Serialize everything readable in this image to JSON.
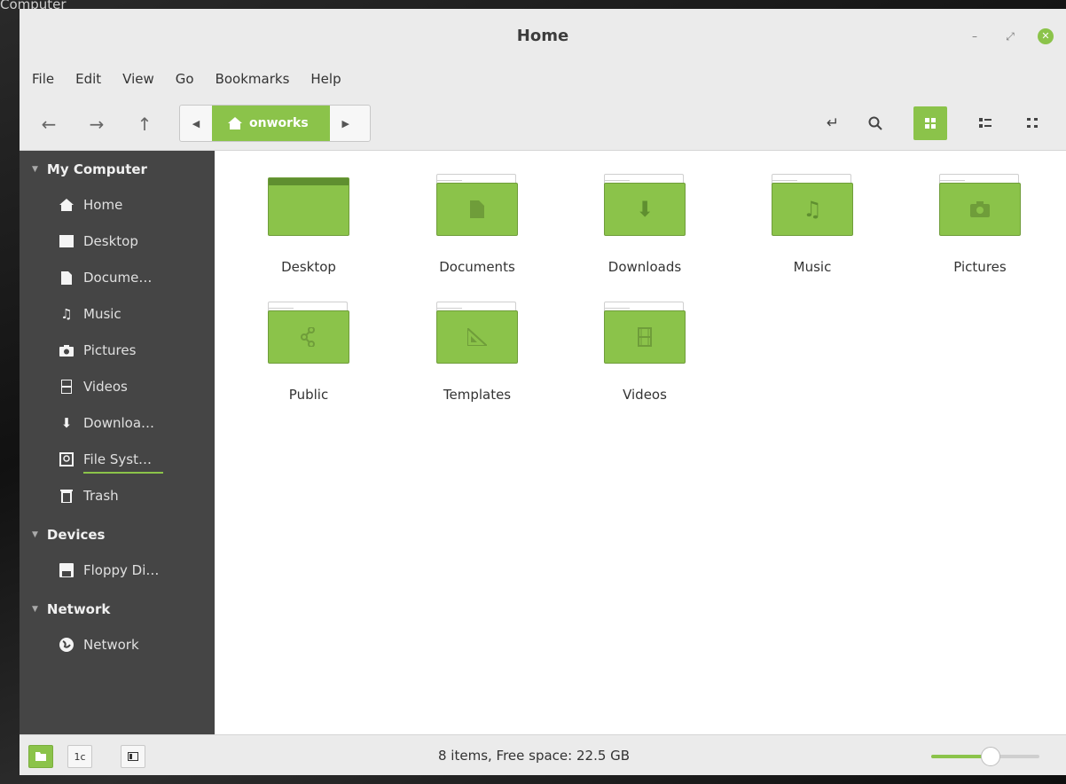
{
  "desktop": {
    "label": "Computer"
  },
  "window": {
    "title": "Home"
  },
  "menu": [
    "File",
    "Edit",
    "View",
    "Go",
    "Bookmarks",
    "Help"
  ],
  "toolbar": {
    "location": "onworks"
  },
  "sidebar": {
    "sections": [
      {
        "header": "My Computer",
        "items": [
          {
            "label": "Home",
            "icon": "home-icon"
          },
          {
            "label": "Desktop",
            "icon": "desktop-icon"
          },
          {
            "label": "Docume…",
            "icon": "document-icon"
          },
          {
            "label": "Music",
            "icon": "music-icon"
          },
          {
            "label": "Pictures",
            "icon": "camera-icon"
          },
          {
            "label": "Videos",
            "icon": "film-icon"
          },
          {
            "label": "Downloa…",
            "icon": "download-icon"
          },
          {
            "label": "File Syst…",
            "icon": "drive-icon"
          },
          {
            "label": "Trash",
            "icon": "trash-icon"
          }
        ]
      },
      {
        "header": "Devices",
        "items": [
          {
            "label": "Floppy Di…",
            "icon": "floppy-icon"
          }
        ]
      },
      {
        "header": "Network",
        "items": [
          {
            "label": "Network",
            "icon": "globe-icon"
          }
        ]
      }
    ]
  },
  "folders": [
    {
      "label": "Desktop",
      "icon": "desktop-folder-icon"
    },
    {
      "label": "Documents",
      "icon": "document-folder-icon"
    },
    {
      "label": "Downloads",
      "icon": "download-folder-icon"
    },
    {
      "label": "Music",
      "icon": "music-folder-icon"
    },
    {
      "label": "Pictures",
      "icon": "pictures-folder-icon"
    },
    {
      "label": "Public",
      "icon": "share-folder-icon"
    },
    {
      "label": "Templates",
      "icon": "templates-folder-icon"
    },
    {
      "label": "Videos",
      "icon": "videos-folder-icon"
    }
  ],
  "status": {
    "text": "8 items, Free space: 22.5 GB",
    "zoom_level": 0.55
  },
  "colors": {
    "accent": "#8bc34a",
    "sidebar_bg": "#454545"
  }
}
